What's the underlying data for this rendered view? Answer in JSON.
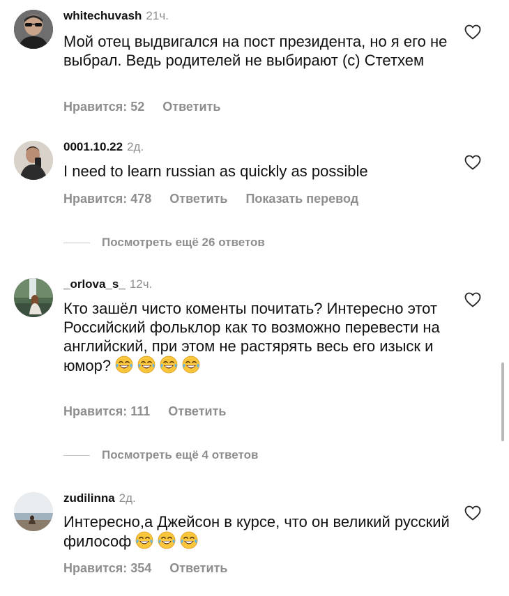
{
  "comments": [
    {
      "username": "whitechuvash",
      "time": "21ч.",
      "text": "Мой отец выдвигался на пост президента, но я его не выбрал. Ведь родителей не выбирают (с) Стетхем",
      "likes": "Нравится: 52",
      "reply": "Ответить",
      "avatar_icon": "man-sunglasses-avatar",
      "liked": false
    },
    {
      "username": "0001.10.22",
      "time": "2д.",
      "text": "I need to learn russian as quickly as possible",
      "likes": "Нравится: 478",
      "reply": "Ответить",
      "translate": "Показать перевод",
      "avatar_icon": "mirror-selfie-avatar",
      "liked": false
    },
    {
      "username": "_orlova_s_",
      "time": "12ч.",
      "text": "Кто зашёл чисто коменты почитать? Интересно этот Российский фольклор как то возможно перевести на английский, при этом не растярять весь его изыск и юмор?",
      "emoji_count": 4,
      "likes": "Нравится: 111",
      "reply": "Ответить",
      "avatar_icon": "woman-waterfall-avatar",
      "liked": false
    },
    {
      "username": "zudilinna",
      "time": "2д.",
      "text": "Интересно,а Джейсон в курсе, что он великий русский философ",
      "emoji_count": 3,
      "likes": "Нравится: 354",
      "reply": "Ответить",
      "avatar_icon": "beach-seated-avatar",
      "liked": false
    }
  ],
  "view_more": [
    {
      "label": "Посмотреть ещё 26 ответов"
    },
    {
      "label": "Посмотреть ещё 4 ответов"
    }
  ],
  "icons": {
    "like": "heart-outline-icon",
    "emoji": "face-with-tears-of-joy-icon"
  },
  "colors": {
    "text": "#111111",
    "secondary": "#8e8e8e",
    "divider": "#c7c7c7",
    "emoji_face": "#f9c63c"
  }
}
